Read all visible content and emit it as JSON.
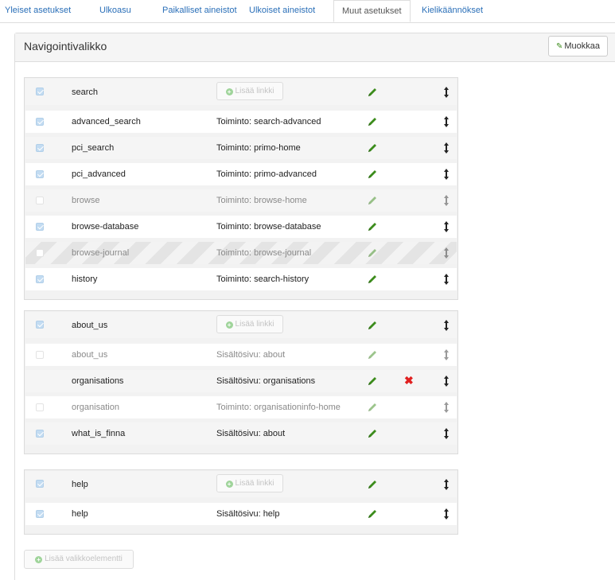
{
  "tabs": [
    {
      "label": "Yleiset asetukset",
      "active": false
    },
    {
      "label": "Ulkoasu",
      "active": false
    },
    {
      "label": "Paikalliset aineistot",
      "active": false
    },
    {
      "label": "Ulkoiset aineistot",
      "active": false
    },
    {
      "label": "Muut asetukset",
      "active": true
    },
    {
      "label": "Kielikäännökset",
      "active": false
    }
  ],
  "panel": {
    "title": "Navigointivalikko",
    "edit_label": "Muokkaa",
    "add_link_label": "Lisää linkki",
    "add_menu_item_label": "Lisää valikkoelementti"
  },
  "colors": {
    "link": "#2a6fb8",
    "pencil": "#3c8c1c",
    "delete": "#e02020",
    "checkbox_checked": "#c3dcf2"
  },
  "groups": [
    {
      "header": {
        "name": "search",
        "checked": true
      },
      "items": [
        {
          "name": "advanced_search",
          "value": "Toiminto: search-advanced",
          "checked": true,
          "disabled": false
        },
        {
          "name": "pci_search",
          "value": "Toiminto: primo-home",
          "checked": true,
          "disabled": false
        },
        {
          "name": "pci_advanced",
          "value": "Toiminto: primo-advanced",
          "checked": true,
          "disabled": false
        },
        {
          "name": "browse",
          "value": "Toiminto: browse-home",
          "checked": false,
          "disabled": true
        },
        {
          "name": "browse-database",
          "value": "Toiminto: browse-database",
          "checked": true,
          "disabled": false
        },
        {
          "name": "browse-journal",
          "value": "Toiminto: browse-journal",
          "checked": false,
          "disabled": true,
          "striped": true
        },
        {
          "name": "history",
          "value": "Toiminto: search-history",
          "checked": true,
          "disabled": false
        }
      ]
    },
    {
      "header": {
        "name": "about_us",
        "checked": true
      },
      "items": [
        {
          "name": "about_us",
          "value": "Sisältösivu: about",
          "checked": false,
          "disabled": true
        },
        {
          "name": "organisations",
          "value": "Sisältösivu: organisations",
          "checked": null,
          "disabled": false,
          "deletable": true
        },
        {
          "name": "organisation",
          "value": "Toiminto: organisationinfo-home",
          "checked": false,
          "disabled": true
        },
        {
          "name": "what_is_finna",
          "value": "Sisältösivu: about",
          "checked": true,
          "disabled": false
        }
      ]
    },
    {
      "header": {
        "name": "help",
        "checked": true
      },
      "items": [
        {
          "name": "help",
          "value": "Sisältösivu: help",
          "checked": true,
          "disabled": false
        }
      ]
    }
  ]
}
